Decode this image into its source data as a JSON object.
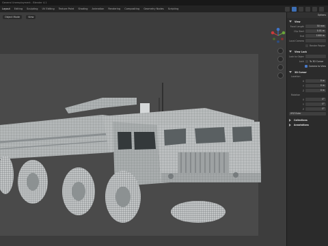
{
  "app": {
    "title": "General Unemployment - Blender 4.1",
    "workspaces": [
      "Layout",
      "Editing",
      "Sculpting",
      "UV Editing",
      "Texture Paint",
      "Shading",
      "Animation",
      "Rendering",
      "Compositing",
      "Geometry Nodes",
      "Scripting"
    ],
    "active_workspace": "Layout"
  },
  "viewport": {
    "header_mode": "Object Mode",
    "view_menu": "View",
    "shading": "Wireframe",
    "accent": "#4a7ac8",
    "colors": {
      "bg": "#3d3d3d",
      "frame": "#4a4a4a",
      "mesh": "#b9bcbd",
      "wire": "#555a5c"
    }
  },
  "npanel": {
    "options_label": "Options",
    "view_section": {
      "title": "View",
      "rows": [
        {
          "label": "Focal Length",
          "value": "50 mm"
        },
        {
          "label": "Clip Start",
          "value": "0.01 m"
        },
        {
          "label": "End",
          "value": "1000 m"
        },
        {
          "label": "Local Camera",
          "value": ""
        },
        {
          "label": "Render Region",
          "value": ""
        }
      ]
    },
    "view_lock": {
      "title": "View Lock",
      "lock_to_object": "Lock to Object",
      "lock": "Lock",
      "to_3d_cursor": "To 3D Cursor",
      "camera_to_view": "Camera to View"
    },
    "cursor": {
      "title": "3D Cursor",
      "location_label": "Location",
      "location": [
        {
          "axis": "X",
          "value": "0 m"
        },
        {
          "axis": "Y",
          "value": "0 m"
        },
        {
          "axis": "Z",
          "value": "0 m"
        }
      ],
      "rotation_label": "Rotation",
      "rotation": [
        {
          "axis": "X",
          "value": "0°"
        },
        {
          "axis": "Y",
          "value": "0°"
        },
        {
          "axis": "Z",
          "value": "0°"
        }
      ],
      "mode": "XYZ Euler"
    },
    "collapsed": [
      "Collections",
      "Annotations"
    ]
  }
}
